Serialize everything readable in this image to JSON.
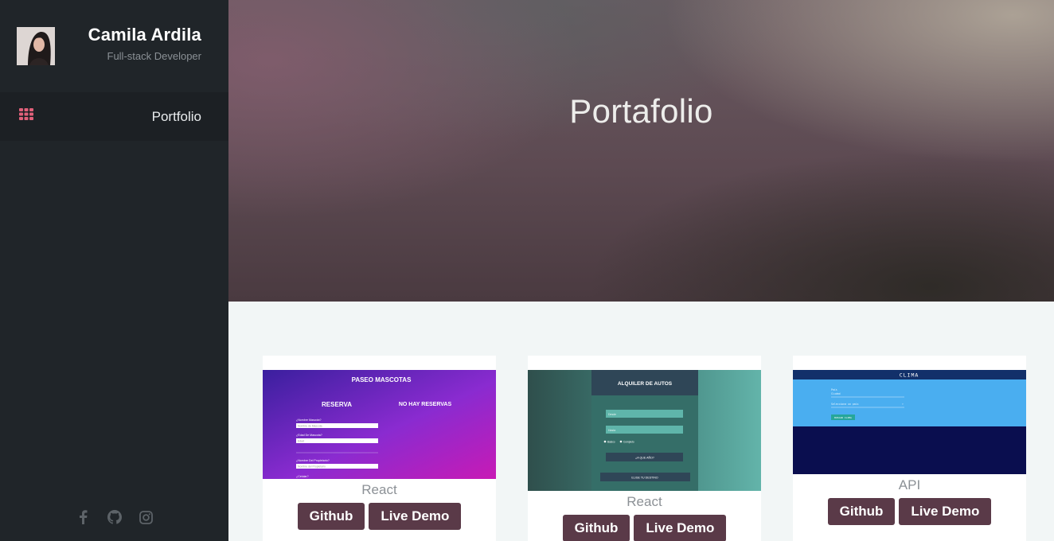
{
  "sidebar": {
    "name": "Camila Ardila",
    "role": "Full-stack Developer",
    "nav": [
      {
        "label": "Portfolio",
        "icon": "grid-icon"
      }
    ],
    "socials": [
      "facebook-icon",
      "github-icon",
      "instagram-icon"
    ]
  },
  "hero": {
    "title": "Portafolio"
  },
  "projects": [
    {
      "tech": "React",
      "github_label": "Github",
      "demo_label": "Live Demo",
      "thumb": {
        "title": "PASEO MASCOTAS",
        "left_heading": "RESERVA",
        "right_heading": "NO HAY RESERVAS",
        "fields": [
          "¿Nombre Mascota?",
          "¿Edad De Mascota?",
          "¿Nombre Del Propietario?",
          "¿Celular?"
        ],
        "placeholders": [
          "Nombre de Mascota",
          "Edad",
          "Nombre del Propietario"
        ]
      }
    },
    {
      "tech": "React",
      "github_label": "Github",
      "demo_label": "Live Demo",
      "thumb": {
        "title": "ALQUILER DE AUTOS",
        "placeholders": [
          "Desde",
          "Hasta"
        ],
        "radios": [
          "Básico",
          "Completo"
        ],
        "primary_button": "¿A QUE AÑO?",
        "secondary_button": "ELIGE TU DESTINO"
      }
    },
    {
      "tech": "API",
      "github_label": "Github",
      "demo_label": "Live Demo",
      "thumb": {
        "title": "CLIMA",
        "field_label": "País",
        "field_value": "Ciudad",
        "select_value": "Selecciona un país",
        "button": "BUSCAR CLIMA"
      }
    }
  ],
  "colors": {
    "sidebar_bg": "#202529",
    "accent_pink": "#e0607a",
    "button_bg": "#5a3a48",
    "content_bg": "#f2f6f6"
  }
}
